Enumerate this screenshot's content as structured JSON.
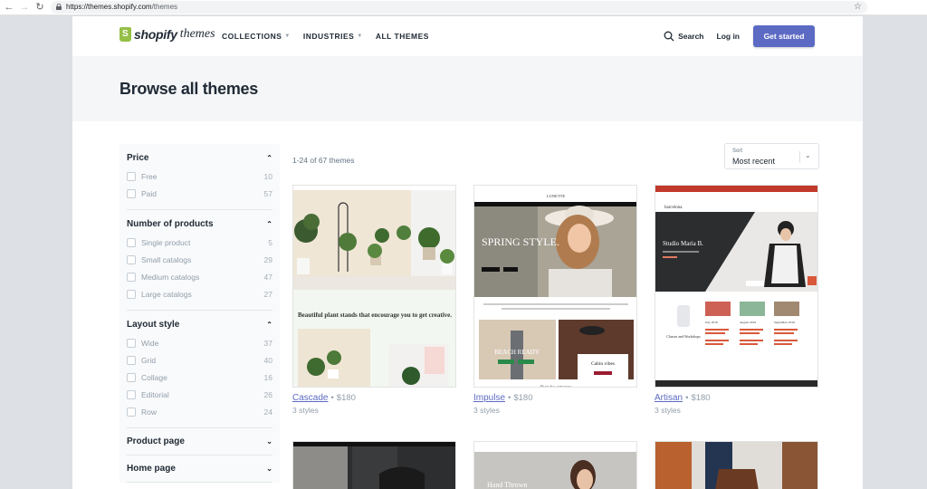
{
  "browser": {
    "url_host": "https://themes.shopify.com",
    "url_path": "/themes",
    "back_icon": "arrow-left",
    "forward_icon": "arrow-right",
    "reload_icon": "reload",
    "bookmark_icon": "star"
  },
  "header": {
    "logo_brand": "shopify",
    "logo_sub": "themes",
    "nav": [
      {
        "label": "COLLECTIONS",
        "has_dropdown": true
      },
      {
        "label": "INDUSTRIES",
        "has_dropdown": true
      },
      {
        "label": "ALL THEMES",
        "has_dropdown": false
      }
    ],
    "search_label": "Search",
    "login_label": "Log in",
    "cta_label": "Get started",
    "accent_color": "#5c6ac4"
  },
  "hero": {
    "title": "Browse all themes"
  },
  "filters": [
    {
      "title": "Price",
      "expanded": true,
      "options": [
        {
          "label": "Free",
          "count": "10"
        },
        {
          "label": "Paid",
          "count": "57"
        }
      ]
    },
    {
      "title": "Number of products",
      "expanded": true,
      "options": [
        {
          "label": "Single product",
          "count": "5"
        },
        {
          "label": "Small catalogs",
          "count": "29"
        },
        {
          "label": "Medium catalogs",
          "count": "47"
        },
        {
          "label": "Large catalogs",
          "count": "27"
        }
      ]
    },
    {
      "title": "Layout style",
      "expanded": true,
      "options": [
        {
          "label": "Wide",
          "count": "37"
        },
        {
          "label": "Grid",
          "count": "40"
        },
        {
          "label": "Collage",
          "count": "16"
        },
        {
          "label": "Editorial",
          "count": "26"
        },
        {
          "label": "Row",
          "count": "24"
        }
      ]
    },
    {
      "title": "Product page",
      "expanded": false,
      "options": []
    },
    {
      "title": "Home page",
      "expanded": false,
      "options": []
    }
  ],
  "results": {
    "count_text": "1-24 of 67 themes",
    "sort_label": "Sort",
    "sort_value": "Most recent"
  },
  "themes": [
    {
      "name": "Cascade",
      "price": "$180",
      "styles": "3 styles",
      "preview_headline": "Beautiful plant stands that encourage you to get creative."
    },
    {
      "name": "Impulse",
      "price": "$180",
      "styles": "3 styles",
      "preview_brand": "LUNETTE",
      "preview_hero": "SPRING STYLE.",
      "preview_sub": "BEACH READY",
      "preview_card": "Cabin vibes",
      "preview_footer": "Shop by category"
    },
    {
      "name": "Artisan",
      "price": "$180",
      "styles": "3 styles",
      "preview_brand": "barcelona",
      "preview_hero": "Studio Maria B.",
      "preview_months": [
        "July 2018",
        "August 2018",
        "September 2018"
      ],
      "preview_side": "Classes and Workshops"
    }
  ],
  "themes_row2": [
    {
      "preview_text": ""
    },
    {
      "preview_text": "Hand Thrown"
    },
    {
      "preview_text": ""
    }
  ],
  "separator": "•"
}
